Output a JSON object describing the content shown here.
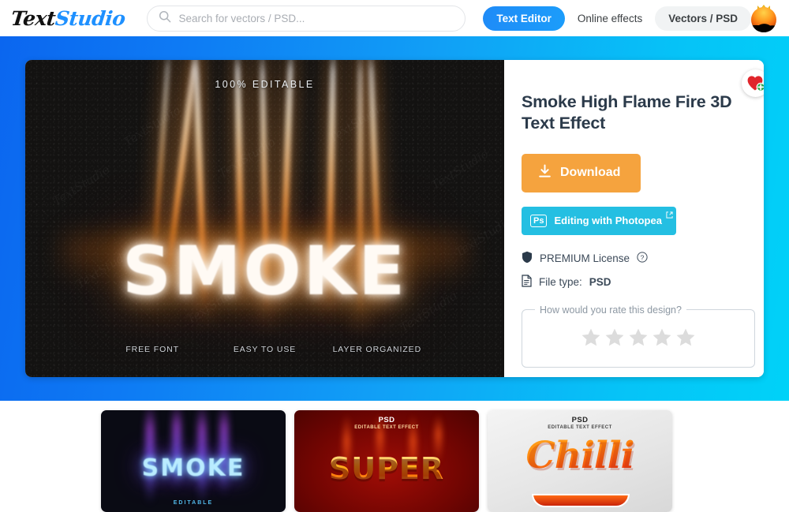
{
  "header": {
    "logo_part1": "Text",
    "logo_part2": "Studio",
    "search_placeholder": "Search for vectors / PSD...",
    "search_value": "",
    "nav": {
      "text_editor": "Text Editor",
      "online_effects": "Online effects",
      "vectors_psd": "Vectors / PSD"
    }
  },
  "preview": {
    "editable_badge": "100% EDITABLE",
    "hero_word": "SMOKE",
    "features": [
      "FREE FONT",
      "EASY TO USE",
      "LAYER ORGANIZED"
    ],
    "watermark": "TextStudio"
  },
  "info": {
    "title": "Smoke High Flame Fire 3D Text Effect",
    "download_label": "Download",
    "photopea_label": "Editing with Photopea",
    "photopea_badge": "Ps",
    "license_label": "PREMIUM License",
    "help_glyph": "?",
    "filetype_label": "File type:",
    "filetype_value": "PSD",
    "rating_legend": "How would you rate this design?",
    "rating_stars": 5,
    "rating_value": 0
  },
  "thumbnails": [
    {
      "name": "smoke-neon",
      "word": "SMOKE",
      "subtitle": "EDITABLE",
      "tag": "",
      "tag_sub": ""
    },
    {
      "name": "super-fire",
      "word": "SUPER",
      "subtitle": "",
      "tag": "PSD",
      "tag_sub": "EDITABLE TEXT EFFECT"
    },
    {
      "name": "chilli-script",
      "word": "Chilli",
      "subtitle": "",
      "tag": "PSD",
      "tag_sub": "EDITABLE TEXT EFFECT"
    }
  ],
  "colors": {
    "brand_blue": "#1e90ff",
    "banner_from": "#0b66ef",
    "banner_to": "#00d2f8",
    "download_orange": "#f5a33e",
    "photopea_cyan": "#24bfe2",
    "favorite_red": "#e0252b",
    "favorite_badge_green": "#2fa84f",
    "star_grey": "#dcdcdc"
  }
}
